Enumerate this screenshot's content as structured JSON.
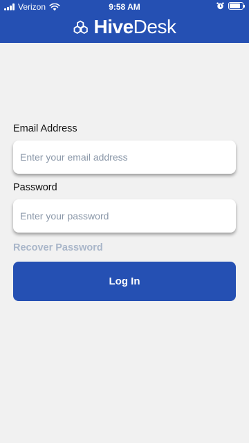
{
  "status_bar": {
    "carrier": "Verizon",
    "time": "9:58 AM",
    "battery_level": 0.85,
    "icons": [
      "signal-icon",
      "wifi-icon",
      "alarm-icon",
      "battery-icon"
    ]
  },
  "header": {
    "logo_text_bold": "Hive",
    "logo_text_regular": "Desk",
    "background_color": "#2550b3"
  },
  "login_form": {
    "email_label": "Email Address",
    "email_placeholder": "Enter your email address",
    "email_value": "",
    "password_label": "Password",
    "password_placeholder": "Enter your password",
    "password_value": "",
    "recover_link": "Recover Password",
    "login_button": "Log In"
  },
  "colors": {
    "brand": "#2550b3",
    "background": "#f1f1f1",
    "link_muted": "#a9b6c9",
    "placeholder": "#8a97a8"
  }
}
